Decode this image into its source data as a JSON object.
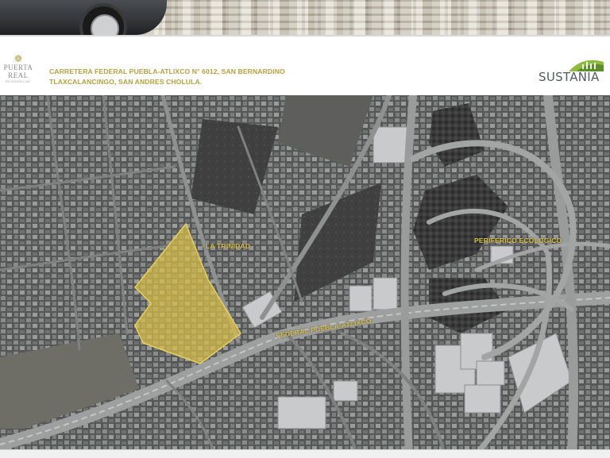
{
  "header": {
    "logo_left": {
      "name": "Puerta Real",
      "line1": "PUERTA",
      "line2": "REAL",
      "subline": "RESIDENCIAL"
    },
    "address_line1": "CARRETERA FEDERAL PUEBLA-ATLIXCO N° 6012, SAN BERNARDINO",
    "address_line2": "TLAXCALANCINGO, SAN ANDRES CHOLULA.",
    "logo_right": {
      "name": "SUSTANIA"
    }
  },
  "map": {
    "labels": {
      "la_trinidad": "LA TRINIDAD",
      "periferico": "PERIFERICO ECOLOGICO",
      "federal": "FEDERAL PUEBLA-ATLIXCO"
    },
    "colors": {
      "highlight": "#d8c048",
      "label": "#d8c048",
      "address": "#b79f3c"
    }
  }
}
